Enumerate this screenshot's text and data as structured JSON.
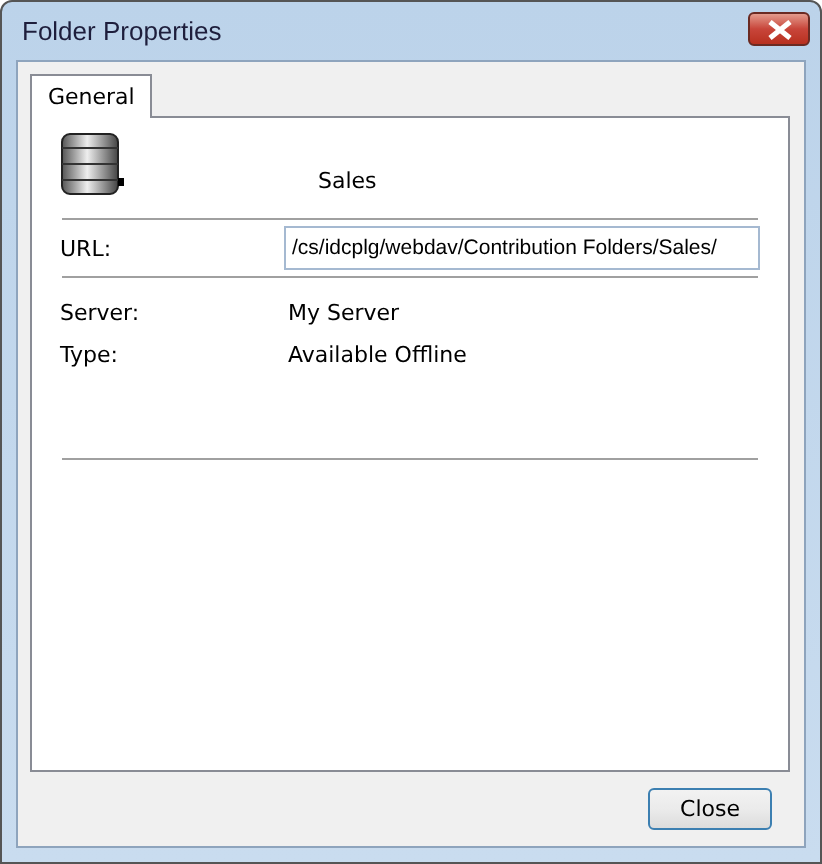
{
  "window": {
    "title": "Folder Properties"
  },
  "tabs": [
    {
      "label": "General",
      "selected": true
    }
  ],
  "header": {
    "name": "Sales"
  },
  "url": {
    "label": "URL:",
    "value": "/cs/idcplg/webdav/Contribution Folders/Sales/"
  },
  "properties": [
    {
      "label": "Server:",
      "value": "My Server"
    },
    {
      "label": "Type:",
      "value": "Available Offline"
    }
  ],
  "buttons": [
    "Close"
  ]
}
